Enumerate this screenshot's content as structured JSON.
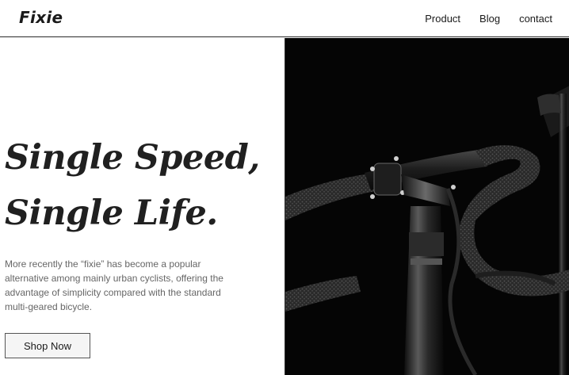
{
  "header": {
    "logo": "Fixie",
    "nav": [
      {
        "label": "Product"
      },
      {
        "label": "Blog"
      },
      {
        "label": "contact"
      }
    ]
  },
  "hero": {
    "headline_line1": "Single Speed,",
    "headline_line2": "Single Life.",
    "description": "More recently the “fixie” has become a popular alternative among mainly urban cyclists, offering the advantage of simplicity compared with the standard multi-geared bicycle.",
    "button_label": "Shop Now"
  },
  "colors": {
    "header_border": "#2a2a2a",
    "text_dark": "#202020",
    "text_muted": "#666666",
    "image_background": "#050505",
    "button_background": "#f5f5f5"
  },
  "image": {
    "subject": "black-and-white bicycle handlebar and stem close-up"
  }
}
